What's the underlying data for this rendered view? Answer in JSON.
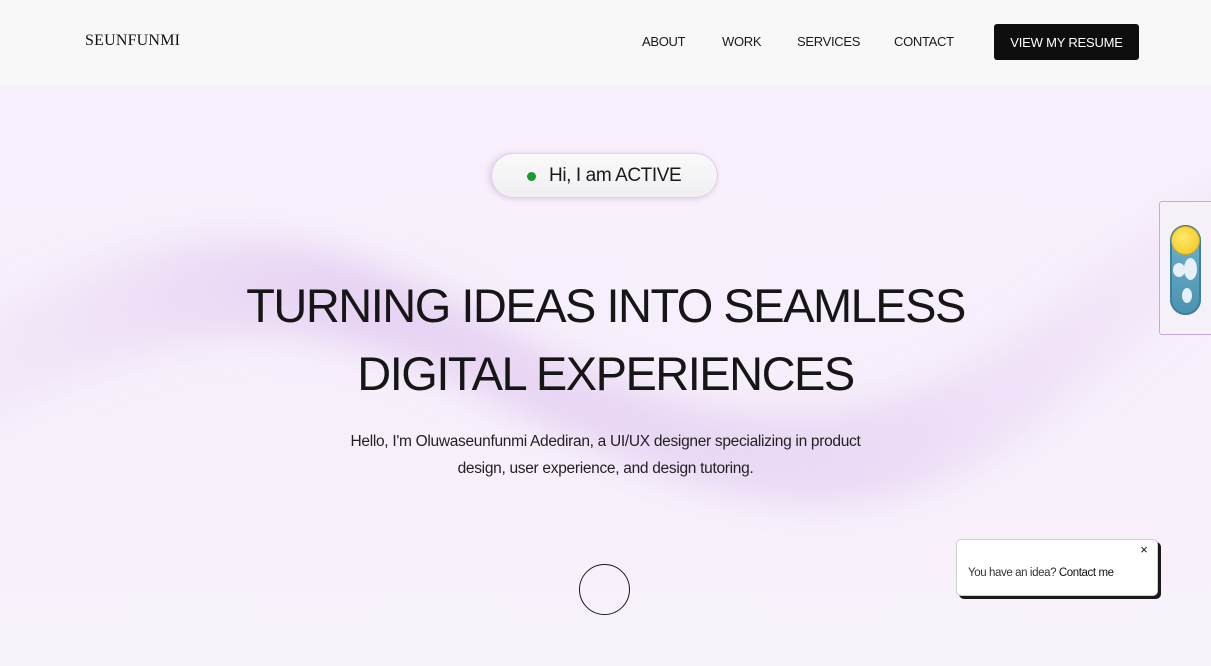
{
  "header": {
    "logo": "SEUNFUNMI",
    "nav": [
      "ABOUT",
      "WORK",
      "SERVICES",
      "CONTACT"
    ],
    "resume_button": "VIEW MY RESUME"
  },
  "status": {
    "text": "Hi, I am ACTIVE",
    "dot_color": "#1d9a2e"
  },
  "hero": {
    "title_line1": "TURNING IDEAS INTO SEAMLESS",
    "title_line2": "DIGITAL EXPERIENCES",
    "subtitle_line1": "Hello, I'm Oluwaseunfunmi Adediran, a UI/UX designer specializing in product",
    "subtitle_line2": "design, user experience, and design tutoring."
  },
  "theme_toggle": {
    "icon": "sun-icon",
    "mode": "light"
  },
  "contact_popup": {
    "prompt": "You have an idea?",
    "link": "Contact me",
    "close_icon": "×"
  },
  "colors": {
    "background": "#f8f1fc",
    "accent": "#c9a8e0",
    "button": "#0e0e0e"
  }
}
